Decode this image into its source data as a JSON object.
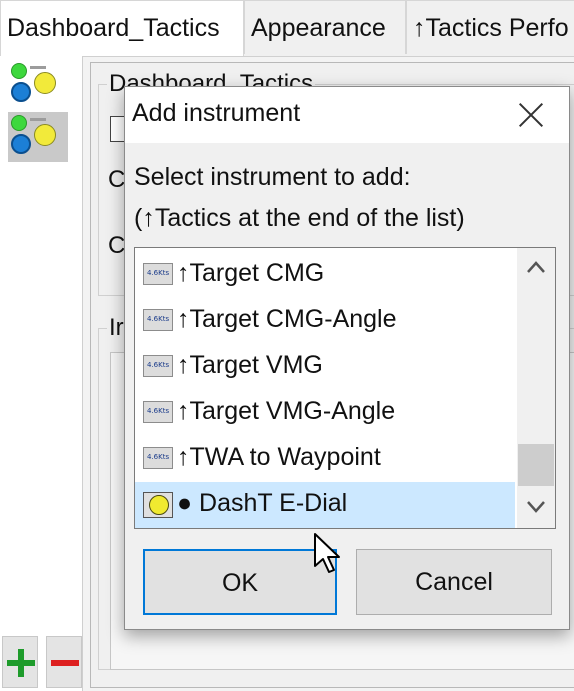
{
  "tabs": [
    {
      "label": "Dashboard_Tactics",
      "active": true
    },
    {
      "label": "Appearance",
      "active": false
    },
    {
      "label": "↑Tactics Perfo",
      "active": false
    }
  ],
  "background": {
    "group1_title": "Dashboard_Tactics",
    "peek_letters": [
      "C",
      "C"
    ],
    "group2_title": "Ir"
  },
  "dialog": {
    "title": "Add instrument",
    "prompt_line1": "Select instrument to add:",
    "prompt_line2": "(↑Tactics at the end of the list)",
    "items": [
      {
        "icon": "kts-icon",
        "icon_text": "4.6Kts",
        "label": "↑Target CMG",
        "selected": false
      },
      {
        "icon": "kts-icon",
        "icon_text": "4.6Kts",
        "label": "↑Target CMG-Angle",
        "selected": false
      },
      {
        "icon": "kts-icon",
        "icon_text": "4.6Kts",
        "label": "↑Target VMG",
        "selected": false
      },
      {
        "icon": "kts-icon",
        "icon_text": "4.6Kts",
        "label": "↑Target VMG-Angle",
        "selected": false
      },
      {
        "icon": "kts-icon",
        "icon_text": "4.6Kts",
        "label": "↑TWA to Waypoint",
        "selected": false
      },
      {
        "icon": "dial-icon",
        "icon_text": "",
        "label": "● DashT E-Dial",
        "selected": true
      }
    ],
    "ok_label": "OK",
    "cancel_label": "Cancel"
  },
  "colors": {
    "accent": "#0078d7",
    "selection": "#cce8ff",
    "add_green": "#1e9b2b",
    "remove_red": "#dd2020"
  }
}
